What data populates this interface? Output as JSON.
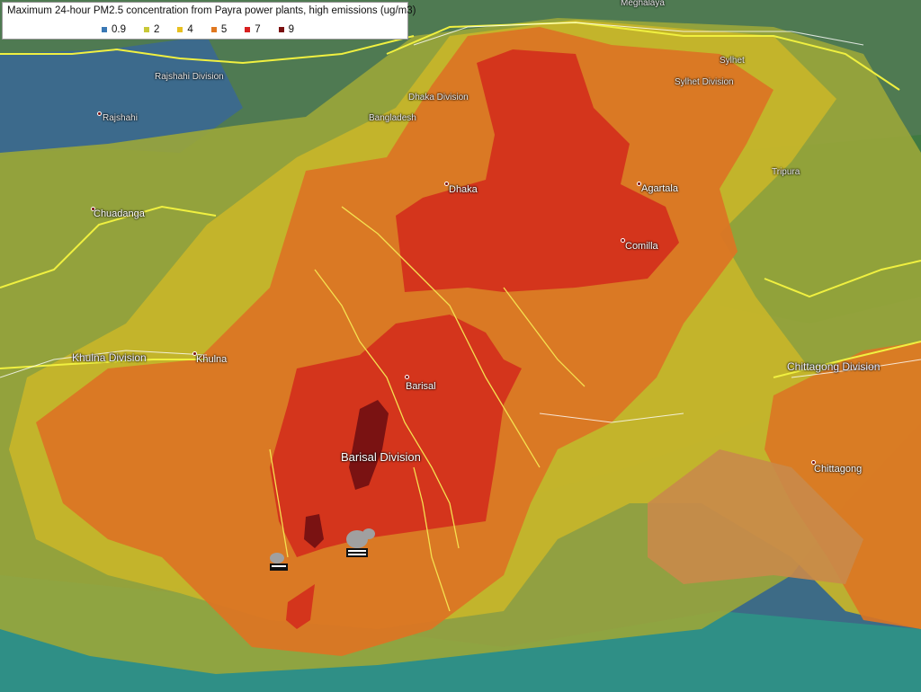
{
  "legend": {
    "title": "Maximum 24-hour PM2.5 concentration from Payra power plants, high emissions (ug/m3)",
    "items": [
      {
        "label": "0.9",
        "color": "#3a78b5"
      },
      {
        "label": "2",
        "color": "#c8c838"
      },
      {
        "label": "4",
        "color": "#e8c020"
      },
      {
        "label": "5",
        "color": "#e07820"
      },
      {
        "label": "7",
        "color": "#d82020"
      },
      {
        "label": "9",
        "color": "#7a1010"
      }
    ]
  },
  "labels": {
    "meghalaya": "Meghalaya",
    "rajshahi_division": "Rajshahi Division",
    "rajshahi": "Rajshahi",
    "dhaka_division": "Dhaka Division",
    "bangladesh": "Bangladesh",
    "sylhet": "Sylhet",
    "sylhet_division": "Sylhet Division",
    "chuadanga": "Chuadanga",
    "dhaka": "Dhaka",
    "agartala": "Agartala",
    "tripura": "Tripura",
    "comilla": "Comilla",
    "khulna_division": "Khulna Division",
    "khulna": "Khulna",
    "barisal": "Barisal",
    "chittagong_division": "Chittagong Division",
    "barisal_division": "Barisal Division",
    "chittagong": "Chittagong"
  },
  "icons": {
    "power_plant": "factory-icon"
  }
}
